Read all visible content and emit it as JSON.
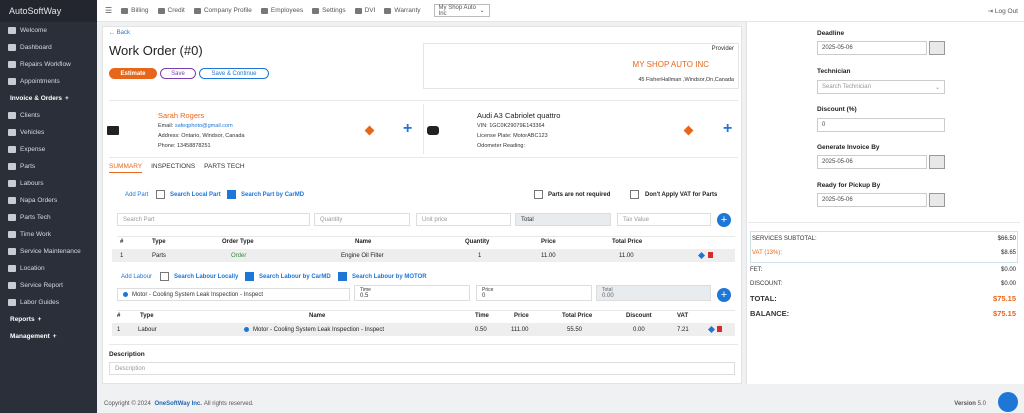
{
  "app": {
    "name": "AutoSoftWay"
  },
  "sidebar": {
    "items": [
      {
        "label": "Welcome",
        "icon": "home-icon"
      },
      {
        "label": "Dashboard",
        "icon": "dashboard-icon"
      },
      {
        "label": "Repairs Workflow",
        "icon": "workflow-icon"
      },
      {
        "label": "Appointments",
        "icon": "calendar-icon"
      },
      {
        "label": "Invoice & Orders",
        "section": true,
        "suffix": "+"
      },
      {
        "label": "Clients",
        "icon": "users-icon"
      },
      {
        "label": "Vehicles",
        "icon": "car-icon"
      },
      {
        "label": "Expense",
        "icon": "money-icon"
      },
      {
        "label": "Parts",
        "icon": "wrench-icon"
      },
      {
        "label": "Labours",
        "icon": "labour-icon"
      },
      {
        "label": "Napa Orders",
        "icon": "napa-icon"
      },
      {
        "label": "Parts Tech",
        "icon": "tech-icon"
      },
      {
        "label": "Time Work",
        "icon": "clock-icon"
      },
      {
        "label": "Service Maintenance",
        "icon": "service-icon"
      },
      {
        "label": "Location",
        "icon": "location-icon"
      },
      {
        "label": "Service Report",
        "icon": "report-icon"
      },
      {
        "label": "Labor Guides",
        "icon": "guide-icon"
      },
      {
        "label": "Reports",
        "section": true,
        "suffix": "+"
      },
      {
        "label": "Management",
        "section": true,
        "suffix": "+"
      }
    ]
  },
  "topbar": {
    "nav": [
      "Billing",
      "Credit",
      "Company Profile",
      "Employees",
      "Settings",
      "DVI",
      "Warranty"
    ],
    "shop_select": "My Shop Auto Inc",
    "logout": "Log Out"
  },
  "page": {
    "back": "Back",
    "title": "Work Order (#0)",
    "buttons": {
      "estimate": "Estimate",
      "save": "Save",
      "save_continue": "Save & Continue"
    }
  },
  "provider": {
    "label": "Provider",
    "name": "MY SHOP AUTO INC",
    "address": "45 FisherHallman ,Windsor,On,Canada"
  },
  "client": {
    "name": "Sarah Rogers",
    "email_label": "Email:",
    "email": "safeqphoto@gmail.com",
    "address": "Address: Ontario, Windsor, Canada",
    "phone": "Phone: 13458878251"
  },
  "vehicle": {
    "name": "Audi A3 Cabriolet quattro",
    "vin": "VIN: 1GC0K29079E143364",
    "plate": "License Plate: MotorABC123",
    "odometer": "Odometer Reading:"
  },
  "tabs": [
    "SUMMARY",
    "INSPECTIONS",
    "PARTS TECH"
  ],
  "parts": {
    "add_part": "Add Part",
    "search_local": "Search Local Part",
    "search_carmd": "Search Part by CarMD",
    "not_required": "Parts are not required",
    "no_vat": "Don't Apply VAT for Parts",
    "search_placeholder": "Search Part",
    "quantity_placeholder": "Quantity",
    "unit_price_placeholder": "Unit price",
    "total_label": "Total",
    "tax_placeholder": "Tax Value",
    "headers": [
      "#",
      "Type",
      "Order Type",
      "Name",
      "Quantity",
      "Price",
      "Total Price"
    ],
    "rows": [
      {
        "num": "1",
        "type": "Parts",
        "order_type": "Order",
        "name": "Engine Oil Filter",
        "quantity": "1",
        "price": "11.00",
        "total": "11.00"
      }
    ]
  },
  "labour": {
    "add_labour": "Add Labour",
    "search_local": "Search Labour Locally",
    "search_carmd": "Search Labour by CarMD",
    "search_motor": "Search Labour by MOTOR",
    "selected": "Motor - Cooling System Leak Inspection - Inspect",
    "time_label": "Time",
    "time_value": "0.5",
    "price_label": "Price",
    "price_value": "0",
    "total_label": "Total",
    "total_value": "0.00",
    "headers": [
      "#",
      "Type",
      "Name",
      "Time",
      "Price",
      "Total Price",
      "Discount",
      "VAT"
    ],
    "rows": [
      {
        "num": "1",
        "type": "Labour",
        "name": "Motor - Cooling System Leak Inspection - Inspect",
        "time": "0.50",
        "price": "111.00",
        "total": "55.50",
        "discount": "0.00",
        "vat": "7.21"
      }
    ]
  },
  "description": {
    "label": "Description",
    "placeholder": "Description"
  },
  "right": {
    "deadline_label": "Deadline",
    "deadline": "2025-05-06",
    "technician_label": "Technician",
    "technician_placeholder": "Search Technician",
    "discount_label": "Discount (%)",
    "discount": "0",
    "gen_invoice_label": "Generate Invoice By",
    "gen_invoice": "2025-05-06",
    "pickup_label": "Ready for Pickup By",
    "pickup": "2025-05-06"
  },
  "summary": {
    "services_subtotal_label": "SERVICES SUBTOTAL:",
    "services_subtotal": "$66.50",
    "vat_label": "VAT (13%):",
    "vat": "$8.65",
    "fet_label": "FET:",
    "fet": "$0.00",
    "discount_label": "DISCOUNT:",
    "discount": "$0.00",
    "total_label": "TOTAL:",
    "total": "$75.15",
    "balance_label": "BALANCE:",
    "balance": "$75.15"
  },
  "footer": {
    "copyright": "Copyright © 2024",
    "brand": "OneSoftWay Inc.",
    "rights": "All rights reserved.",
    "version_label": "Version",
    "version": "5.0"
  },
  "colors": {
    "accent": "#1e76d6",
    "brand_orange": "#e8661a",
    "sidebar": "#2b2f3a"
  }
}
